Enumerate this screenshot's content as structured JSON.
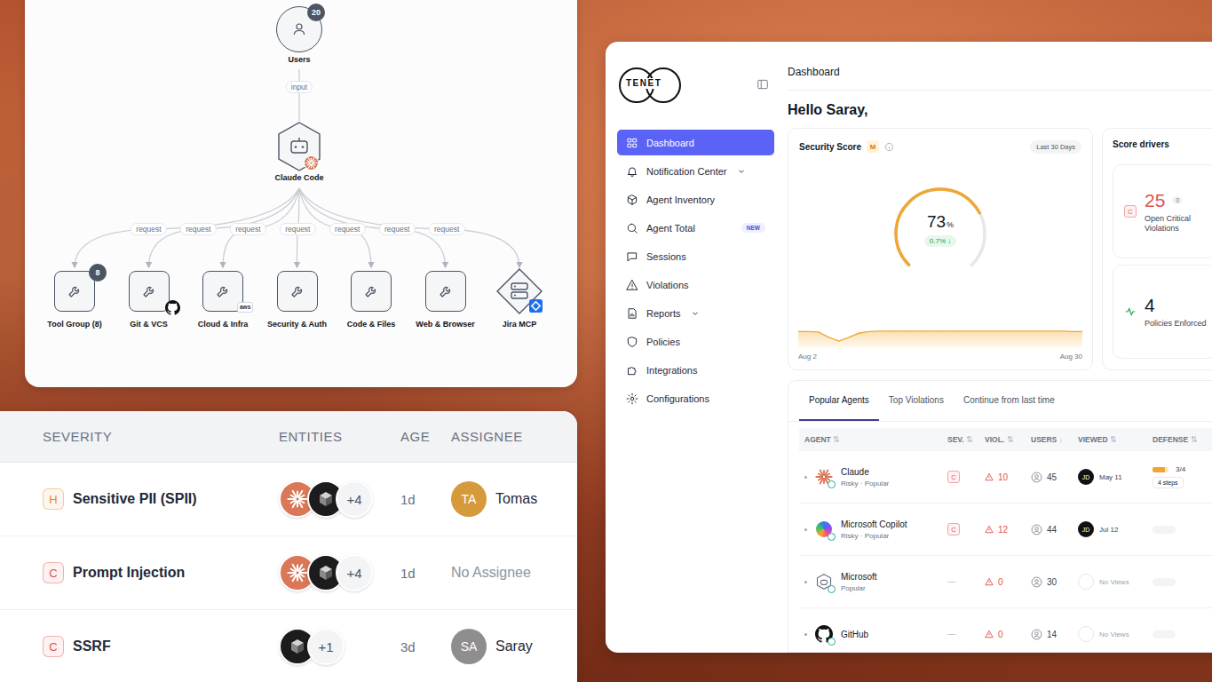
{
  "diagram": {
    "users": {
      "label": "Users",
      "count": "20"
    },
    "input_edge": "input",
    "agent": {
      "label": "Claude Code"
    },
    "tools": [
      {
        "label": "Tool Group (8)",
        "kind": "tool",
        "edge": "request",
        "badge_kind": "count",
        "badge": "8"
      },
      {
        "label": "Git & VCS",
        "kind": "tool",
        "edge": "request",
        "badge_kind": "github"
      },
      {
        "label": "Cloud & Infra",
        "kind": "tool",
        "edge": "request",
        "badge_kind": "aws",
        "badge": "aws"
      },
      {
        "label": "Security & Auth",
        "kind": "tool",
        "edge": "request",
        "badge_kind": "none"
      },
      {
        "label": "Code & Files",
        "kind": "tool",
        "edge": "request",
        "badge_kind": "none"
      },
      {
        "label": "Web & Browser",
        "kind": "tool",
        "edge": "request",
        "badge_kind": "none"
      },
      {
        "label": "Jira MCP",
        "kind": "server",
        "edge": "request",
        "badge_kind": "jira"
      }
    ]
  },
  "violations": {
    "columns": [
      "SEVERITY",
      "ENTITIES",
      "AGE",
      "ASSIGNEE"
    ],
    "rows": [
      {
        "severity": "H",
        "severity_color": "#e8882e",
        "title": "Sensitive PII (SPII)",
        "entities": [
          {
            "kind": "claude"
          },
          {
            "kind": "cube"
          }
        ],
        "more": "+4",
        "age": "1d",
        "assigned": true,
        "initials": "TA",
        "assignee": "Tomas",
        "avatar_color": "#d49a3b"
      },
      {
        "severity": "C",
        "severity_color": "#e0524f",
        "title": "Prompt Injection",
        "entities": [
          {
            "kind": "claude"
          },
          {
            "kind": "cube"
          }
        ],
        "more": "+4",
        "age": "1d",
        "assigned": false,
        "assignee": "No Assignee"
      },
      {
        "severity": "C",
        "severity_color": "#e0524f",
        "title": "SSRF",
        "entities": [
          {
            "kind": "cube"
          }
        ],
        "more": "+1",
        "age": "3d",
        "assigned": true,
        "initials": "SA",
        "assignee": "Saray",
        "avatar_color": "#8e8e8e"
      }
    ]
  },
  "dashboard": {
    "logo": "TENET",
    "nav": [
      {
        "label": "Dashboard",
        "selected": true,
        "expandable": false
      },
      {
        "label": "Notification Center",
        "selected": false,
        "expandable": true
      },
      {
        "label": "Agent Inventory",
        "selected": false,
        "expandable": false
      },
      {
        "label": "Agent Total",
        "selected": false,
        "expandable": false,
        "badge": "NEW"
      },
      {
        "label": "Sessions",
        "selected": false,
        "expandable": false
      },
      {
        "label": "Violations",
        "selected": false,
        "expandable": false
      },
      {
        "label": "Reports",
        "selected": false,
        "expandable": true
      },
      {
        "label": "Policies",
        "selected": false,
        "expandable": false
      },
      {
        "label": "Integrations",
        "selected": false,
        "expandable": false
      },
      {
        "label": "Configurations",
        "selected": false,
        "expandable": false
      }
    ],
    "header": "Dashboard",
    "greeting": "Hello Saray,",
    "score": {
      "title": "Security Score",
      "grade": "M",
      "range": "Last 30 Days",
      "value": "73",
      "unit": "%",
      "level": 0.73,
      "delta": "0.7%",
      "delta_arrow": "↓",
      "series": [
        73.3,
        73.3,
        73.2,
        72.1,
        71.3,
        72.1,
        73.0,
        73.3,
        73.4,
        73.4,
        73.4,
        73.4,
        73.4,
        73.4,
        73.4,
        73.4,
        73.4,
        73.4,
        73.4,
        73.4,
        73.4,
        73.4,
        73.4,
        73.4,
        73.4,
        73.4,
        73.4,
        73.3,
        73.3
      ],
      "x_labels": [
        "Aug 2",
        "Aug 30"
      ]
    },
    "drivers": {
      "title": "Score drivers",
      "items": [
        {
          "kind": "critical",
          "badge": "C",
          "value": "25",
          "count": "0",
          "label": "Open Critical Violations"
        },
        {
          "kind": "policies",
          "value": "4",
          "label": "Policies Enforced"
        }
      ]
    },
    "tabs": [
      {
        "label": "Popular Agents",
        "selected": true
      },
      {
        "label": "Top Violations",
        "selected": false
      },
      {
        "label": "Continue from last time",
        "selected": false
      }
    ],
    "table": {
      "columns": [
        {
          "label": "AGENT",
          "sort": "⇅"
        },
        {
          "label": "SEV.",
          "sort": "⇅"
        },
        {
          "label": "VIOL.",
          "sort": "⇅"
        },
        {
          "label": "USERS",
          "sort": "↓"
        },
        {
          "label": "VIEWED",
          "sort": "⇅"
        },
        {
          "label": "DEFENSE",
          "sort": "⇅"
        }
      ],
      "rows": [
        {
          "kind": "claude",
          "name": "Claude",
          "subtitle": "Risky · Popular",
          "sev_kind": "badge",
          "sev": "C",
          "viol": "10",
          "users": "45",
          "viewed": true,
          "viewer": "JD",
          "date": "May 11",
          "defense": {
            "level": 0.75,
            "score": "3/4",
            "steps": "4 steps"
          }
        },
        {
          "kind": "copilot",
          "name": "Microsoft Copilot",
          "subtitle": "Risky · Popular",
          "sev_kind": "badge",
          "sev": "C",
          "viol": "12",
          "users": "44",
          "viewed": true,
          "viewer": "JD",
          "date": "Jul 12",
          "defense": null
        },
        {
          "kind": "hexbot",
          "name": "Microsoft",
          "subtitle": "Popular",
          "sev_kind": "dash",
          "sev": "—",
          "viol": "0",
          "users": "30",
          "viewed": false,
          "date": "No Views",
          "defense": null
        },
        {
          "kind": "github",
          "name": "GitHub",
          "sev_kind": "dash",
          "sev": "—",
          "viol": "0",
          "users": "14",
          "viewed": false,
          "date": "No Views",
          "defense": null
        }
      ]
    }
  }
}
